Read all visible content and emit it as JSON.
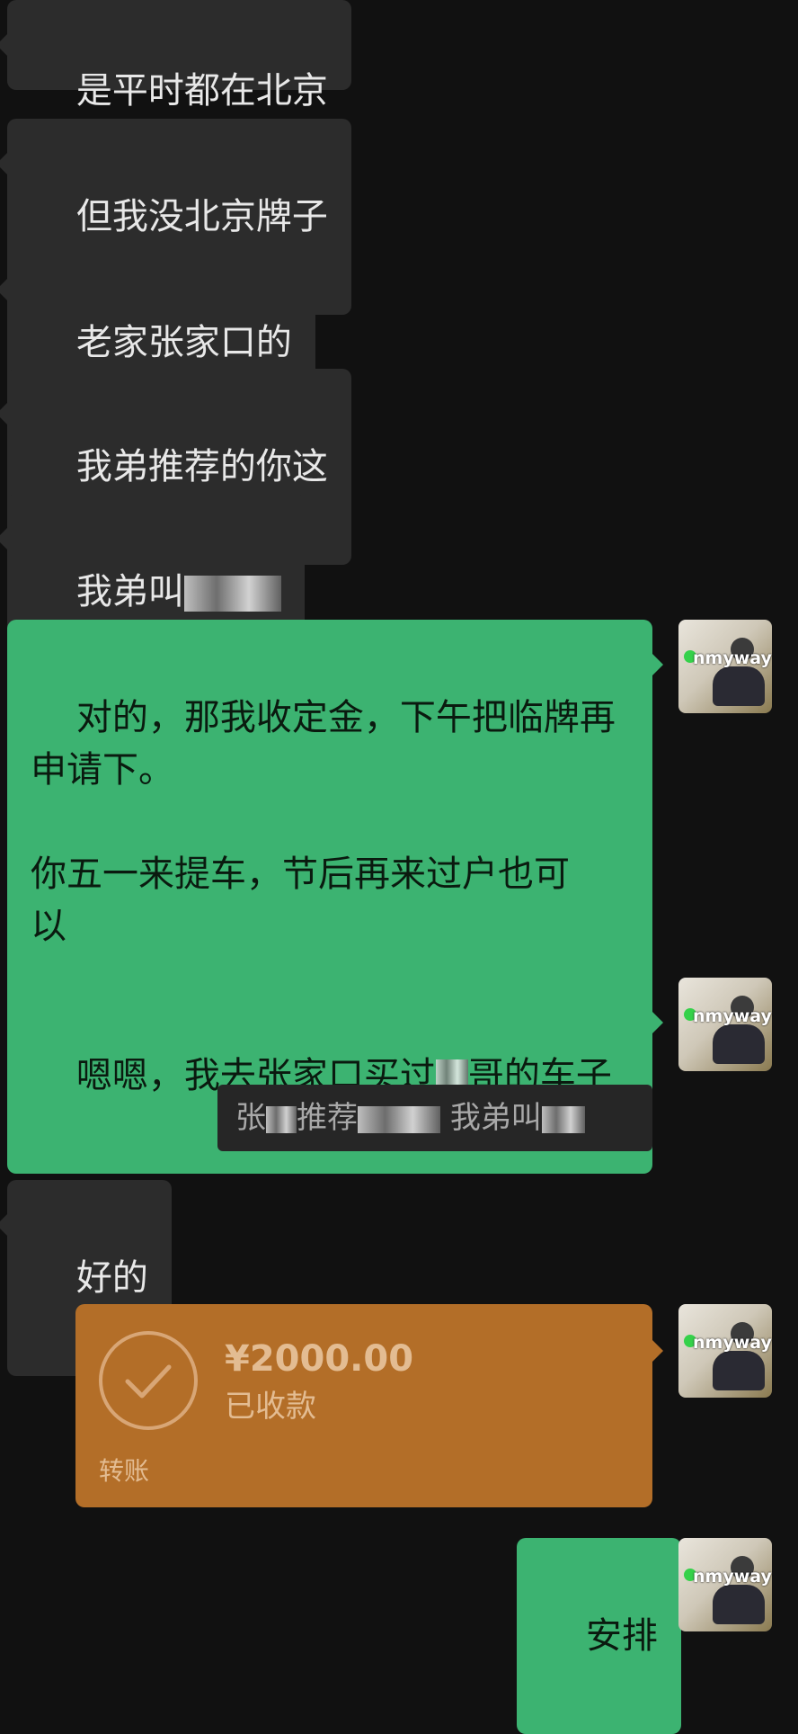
{
  "messages": [
    {
      "side": "in",
      "text": "是平时都在北京"
    },
    {
      "side": "in",
      "text": "但我没北京牌子"
    },
    {
      "side": "in",
      "text": "老家张家口的"
    },
    {
      "side": "in",
      "text": "我弟推荐的你这"
    },
    {
      "side": "in",
      "text": "我弟叫"
    },
    {
      "side": "out",
      "text": "对的，那我收定金，下午把临牌再\n申请下。\n\n你五一来提车，节后再来过户也可\n以"
    },
    {
      "side": "out",
      "text": "嗯嗯，我去张家口买过"
    },
    {
      "side": "out",
      "text": "哥的车子"
    },
    {
      "side": "in",
      "text": "好的"
    },
    {
      "side": "out",
      "text": "安排"
    }
  ],
  "quote": {
    "text_a": "张",
    "text_b": "推荐",
    "text_c": "我弟叫"
  },
  "transfer": {
    "amount": "¥2000.00",
    "status": "已收款",
    "label": "转账"
  },
  "avatar": {
    "name": "nmyway"
  },
  "colors": {
    "background": "#111111",
    "incoming": "#2c2c2c",
    "outgoing": "#3cb371",
    "transfer": "#b36e28"
  }
}
